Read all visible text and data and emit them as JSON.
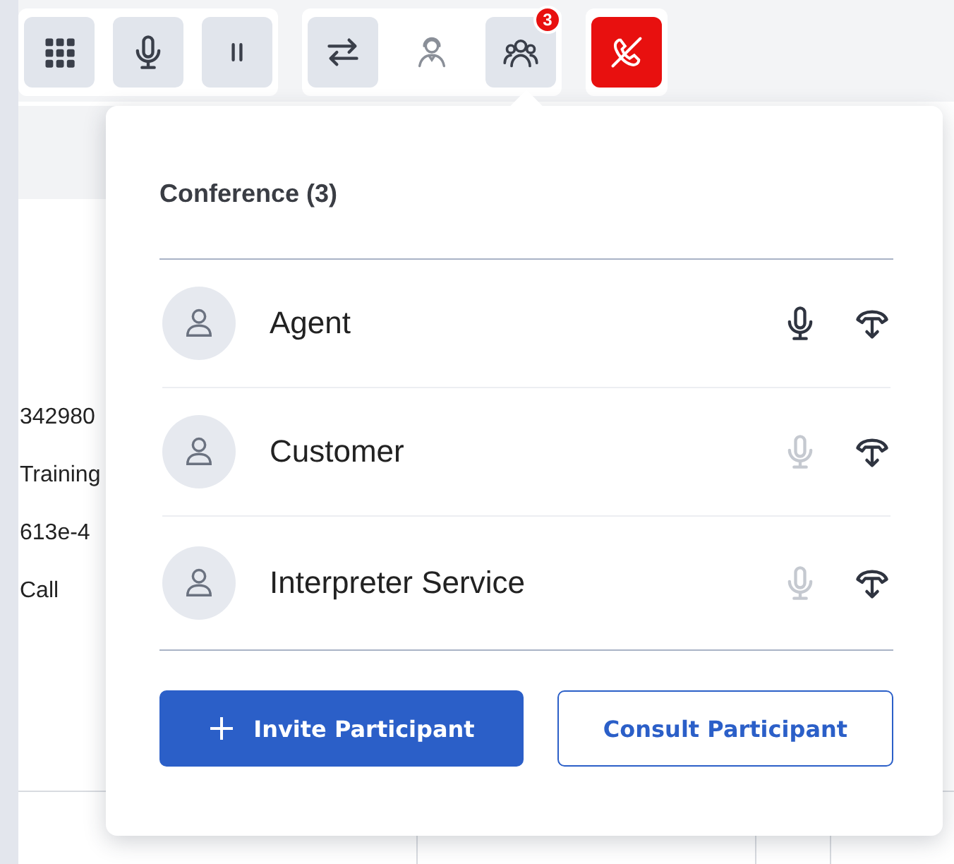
{
  "toolbar": {
    "groups": [
      {
        "buttons": [
          {
            "kind": "keypad",
            "disabled": false
          },
          {
            "kind": "mute",
            "disabled": false
          },
          {
            "kind": "hold",
            "disabled": false
          }
        ]
      },
      {
        "buttons": [
          {
            "kind": "transfer",
            "disabled": false
          },
          {
            "kind": "consult",
            "disabled": true
          },
          {
            "kind": "conference",
            "disabled": false,
            "badge": "3"
          }
        ]
      },
      {
        "buttons": [
          {
            "kind": "hangup",
            "disabled": false
          }
        ]
      }
    ]
  },
  "background": {
    "left_texts": [
      "342980",
      "Training",
      "613e-4",
      "Call"
    ]
  },
  "conference_panel": {
    "title": "Conference (3)",
    "participants": [
      {
        "name": "Agent",
        "mic_enabled": true
      },
      {
        "name": "Customer",
        "mic_enabled": false
      },
      {
        "name": "Interpreter Service",
        "mic_enabled": false
      }
    ],
    "buttons": [
      {
        "label": "Invite Participant",
        "kind": "primary"
      },
      {
        "label": "Consult Participant",
        "kind": "secondary"
      }
    ]
  }
}
